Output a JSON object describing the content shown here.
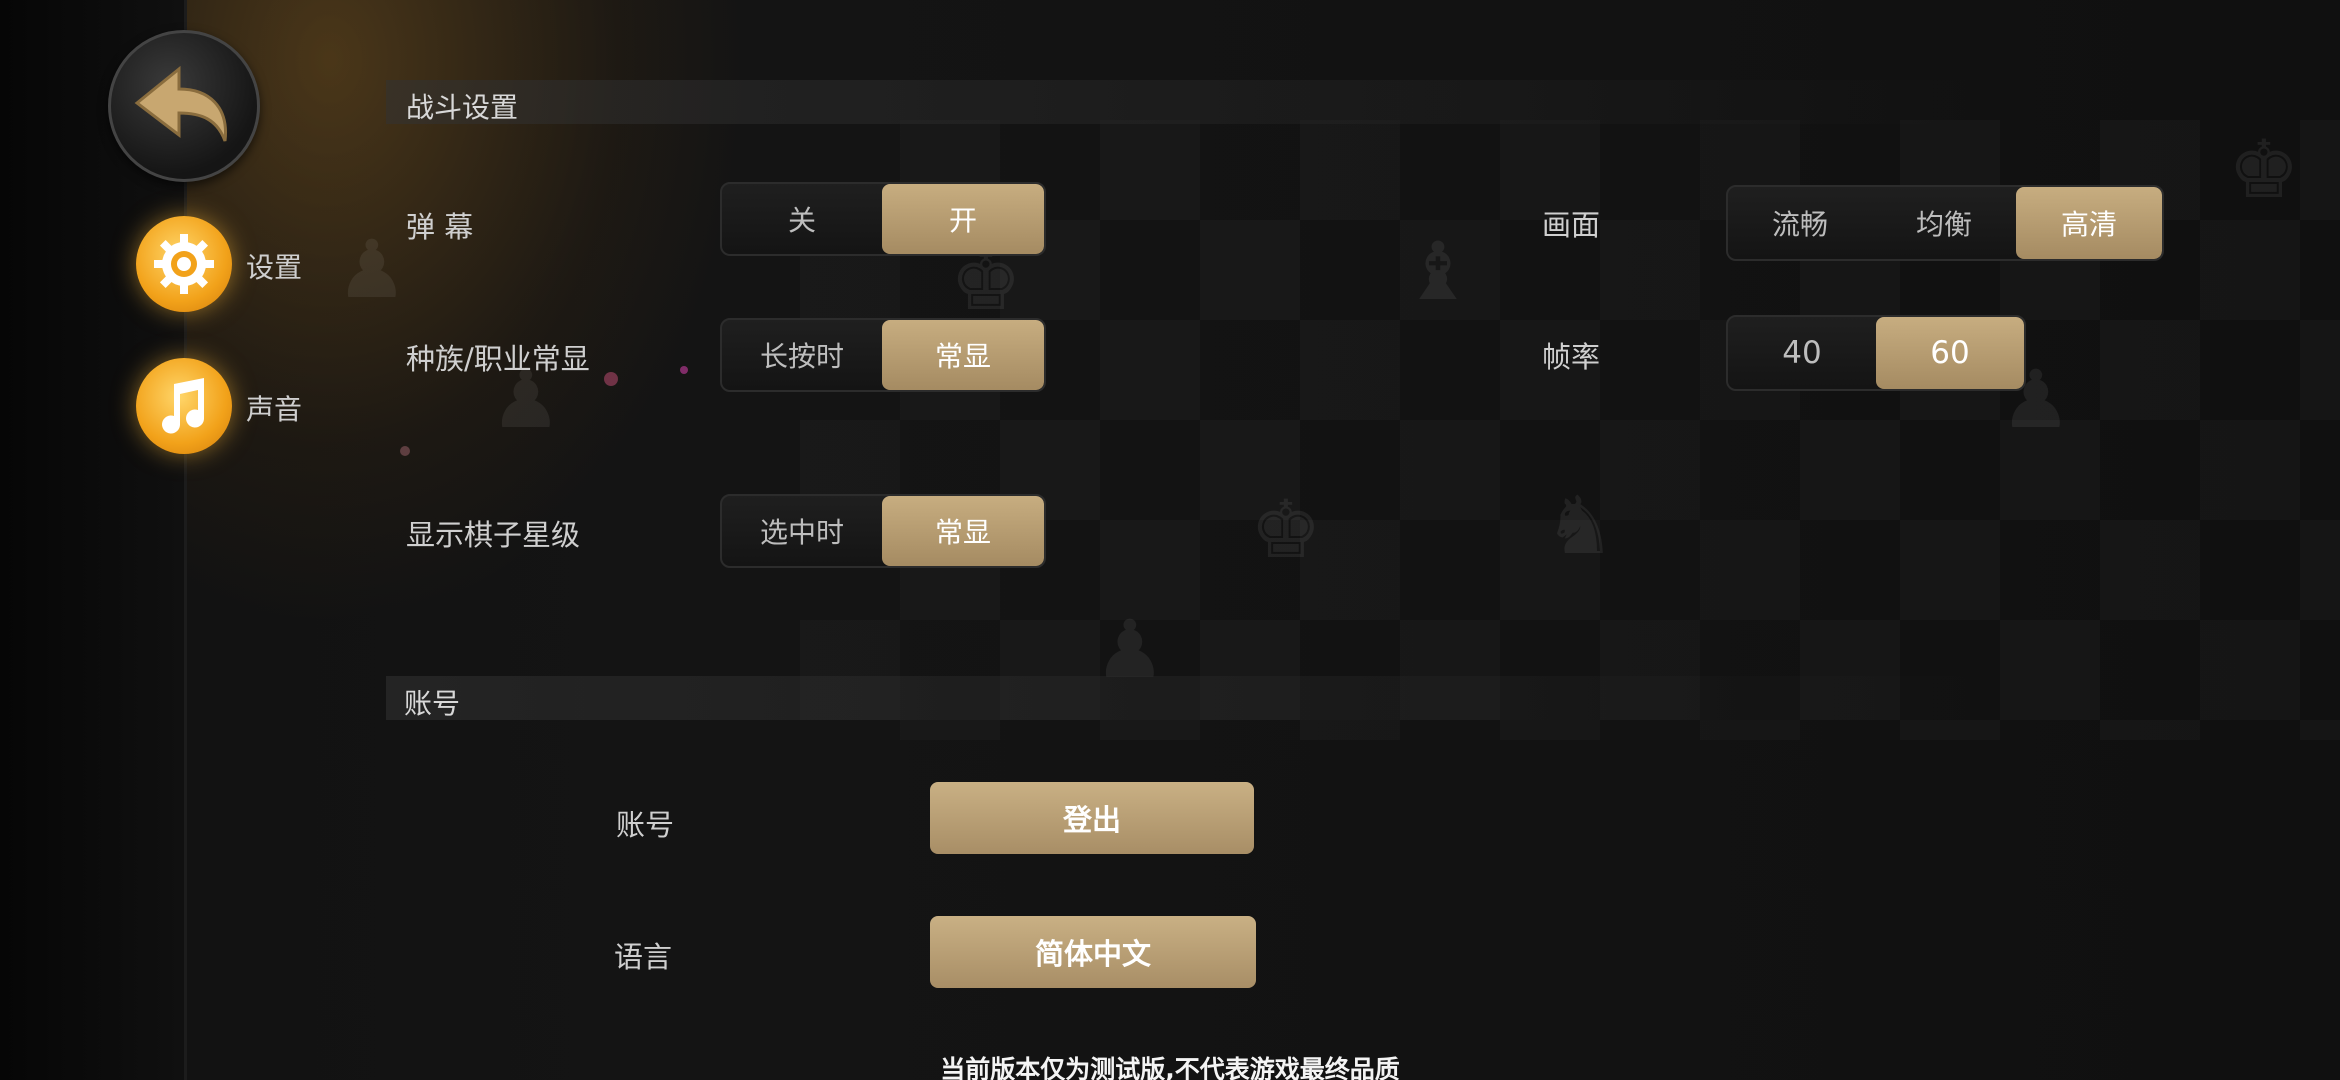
{
  "nav": {
    "back_label": "",
    "items": [
      {
        "label": "设置",
        "icon": "gear-icon"
      },
      {
        "label": "声音",
        "icon": "music-note-icon"
      }
    ]
  },
  "battle_settings": {
    "header": "战斗设置",
    "danmaku": {
      "label": "弹 幕",
      "options": [
        "关",
        "开"
      ],
      "selected": "开"
    },
    "race_class": {
      "label": "种族/职业常显",
      "options": [
        "长按时",
        "常显"
      ],
      "selected": "常显"
    },
    "star_level": {
      "label": "显示棋子星级",
      "options": [
        "选中时",
        "常显"
      ],
      "selected": "常显"
    },
    "graphics": {
      "label": "画面",
      "options": [
        "流畅",
        "均衡",
        "高清"
      ],
      "selected": "高清"
    },
    "framerate": {
      "label": "帧率",
      "options": [
        "40",
        "60"
      ],
      "selected": "60"
    }
  },
  "account": {
    "header": "账号",
    "account_label": "账号",
    "logout_label": "登出",
    "language_label": "语言",
    "language_value": "简体中文"
  },
  "footer_note": "当前版本仅为测试版,不代表游戏最终品质",
  "colors": {
    "accent_gold": "#b89c70",
    "icon_orange": "#f2a21a"
  }
}
